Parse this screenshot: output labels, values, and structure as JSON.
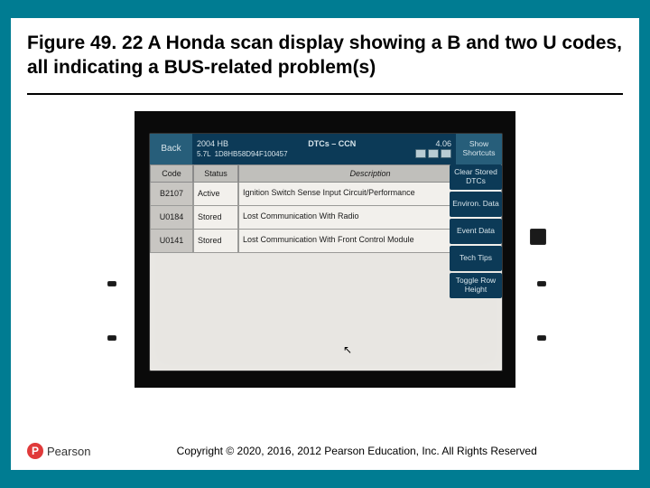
{
  "figure": {
    "title": "Figure 49. 22 A Honda scan display showing a B and two U codes, all indicating a BUS-related problem(s)"
  },
  "scan": {
    "back": "Back",
    "vehicle_year_model": "2004 HB",
    "screen_title": "DTCs – CCN",
    "version": "4.06",
    "engine": "5.7L",
    "vin": "1D8HB58D94F100457",
    "shortcuts": "Show Shortcuts",
    "headers": {
      "code": "Code",
      "status": "Status",
      "description": "Description"
    },
    "rows": [
      {
        "code": "B2107",
        "status": "Active",
        "desc": "Ignition Switch Sense Input Circuit/Performance"
      },
      {
        "code": "U0184",
        "status": "Stored",
        "desc": "Lost Communication With Radio"
      },
      {
        "code": "U0141",
        "status": "Stored",
        "desc": "Lost Communication With Front Control Module"
      }
    ],
    "sidebuttons": [
      "Clear Stored DTCs",
      "Environ. Data",
      "Event Data",
      "Tech Tips",
      "Toggle Row Height"
    ]
  },
  "footer": {
    "brand": "Pearson",
    "copyright": "Copyright © 2020, 2016, 2012 Pearson Education, Inc. All Rights Reserved"
  }
}
